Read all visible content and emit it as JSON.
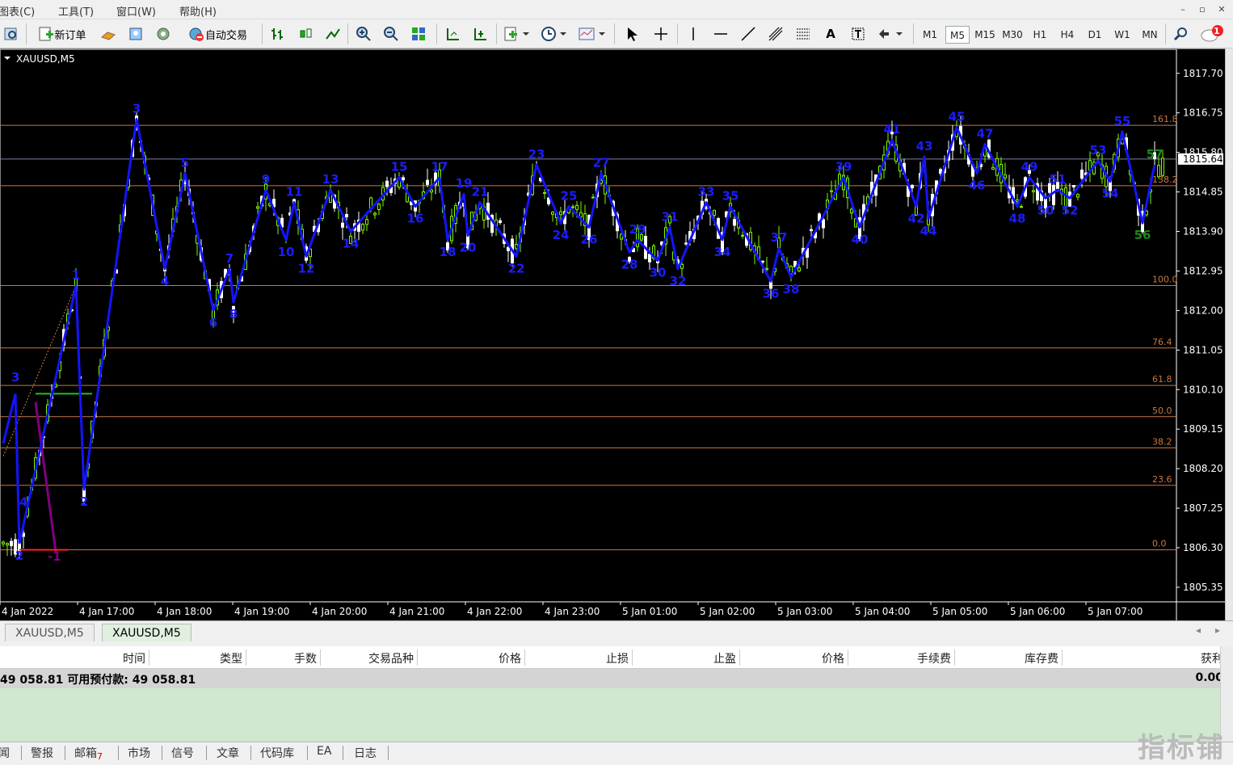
{
  "menu": {
    "items": [
      "图表(C)",
      "工具(T)",
      "窗口(W)",
      "帮助(H)"
    ],
    "controls": [
      "–",
      "▫",
      "✕"
    ]
  },
  "toolbar": {
    "new_order_label": "新订单",
    "auto_trade_label": "自动交易",
    "timeframes": [
      "M1",
      "M5",
      "M15",
      "M30",
      "H1",
      "H4",
      "D1",
      "W1",
      "MN"
    ],
    "active_timeframe": "M5",
    "notification_count": "1"
  },
  "chart": {
    "symbol_label": "XAUUSD,M5",
    "current_price": "1815.64",
    "price_ticks": [
      "1817.70",
      "1816.75",
      "1815.80",
      "1814.85",
      "1813.90",
      "1812.95",
      "1812.00",
      "1811.05",
      "1810.10",
      "1809.15",
      "1808.20",
      "1807.25",
      "1806.30",
      "1805.35"
    ],
    "time_ticks": [
      "4 Jan 2022",
      "4 Jan 17:00",
      "4 Jan 18:00",
      "4 Jan 19:00",
      "4 Jan 20:00",
      "4 Jan 21:00",
      "4 Jan 22:00",
      "4 Jan 23:00",
      "5 Jan 01:00",
      "5 Jan 02:00",
      "5 Jan 03:00",
      "5 Jan 04:00",
      "5 Jan 05:00",
      "5 Jan 06:00",
      "5 Jan 07:00"
    ],
    "fib_levels": [
      {
        "label": "161.8",
        "price": 1816.45
      },
      {
        "label": "138.2",
        "price": 1815.0
      },
      {
        "label": "100.0",
        "price": 1812.6
      },
      {
        "label": "76.4",
        "price": 1811.1
      },
      {
        "label": "61.8",
        "price": 1810.2
      },
      {
        "label": "50.0",
        "price": 1809.45
      },
      {
        "label": "38.2",
        "price": 1808.7
      },
      {
        "label": "23.6",
        "price": 1807.8
      },
      {
        "label": "0.0",
        "price": 1806.25
      }
    ],
    "colors": {
      "zigzag": "#1414ff",
      "fib": "#c87840",
      "label_blue": "#1c1cff",
      "label_green": "#1a8a1a",
      "purple": "#800080",
      "bull": "#7cfc00",
      "bear": "#ffffff"
    }
  },
  "chart_data": {
    "type": "line",
    "title": "XAUUSD,M5",
    "xlabel": "",
    "ylabel": "",
    "ylim": [
      1805.0,
      1818.2
    ],
    "series": [
      {
        "points": [
          {
            "label": "2",
            "t": 4,
            "price": 1806.4
          },
          {
            "label": "1",
            "t": 18,
            "price": 1812.6
          },
          {
            "label": "2",
            "t": 20,
            "price": 1807.7
          },
          {
            "label": "3",
            "t": 33,
            "price": 1816.6
          },
          {
            "label": "4",
            "t": 40,
            "price": 1813.0
          },
          {
            "label": "5",
            "t": 45,
            "price": 1815.3
          },
          {
            "label": "6",
            "t": 52,
            "price": 1812.0
          },
          {
            "label": "7",
            "t": 56,
            "price": 1813.0
          },
          {
            "label": "8",
            "t": 57,
            "price": 1812.2
          },
          {
            "label": "9",
            "t": 65,
            "price": 1814.9
          },
          {
            "label": "10",
            "t": 70,
            "price": 1813.7
          },
          {
            "label": "11",
            "t": 72,
            "price": 1814.6
          },
          {
            "label": "12",
            "t": 75,
            "price": 1813.3
          },
          {
            "label": "13",
            "t": 81,
            "price": 1814.9
          },
          {
            "label": "14",
            "t": 86,
            "price": 1813.9
          },
          {
            "label": "15",
            "t": 98,
            "price": 1815.2
          },
          {
            "label": "16",
            "t": 102,
            "price": 1814.5
          },
          {
            "label": "17",
            "t": 108,
            "price": 1815.2
          },
          {
            "label": "18",
            "t": 110,
            "price": 1813.7
          },
          {
            "label": "19",
            "t": 114,
            "price": 1814.8
          },
          {
            "label": "20",
            "t": 115,
            "price": 1813.8
          },
          {
            "label": "21",
            "t": 118,
            "price": 1814.6
          },
          {
            "label": "22",
            "t": 127,
            "price": 1813.3
          },
          {
            "label": "23",
            "t": 132,
            "price": 1815.5
          },
          {
            "label": "24",
            "t": 138,
            "price": 1814.1
          },
          {
            "label": "25",
            "t": 140,
            "price": 1814.5
          },
          {
            "label": "26",
            "t": 145,
            "price": 1814.0
          },
          {
            "label": "27",
            "t": 148,
            "price": 1815.3
          },
          {
            "label": "28",
            "t": 155,
            "price": 1813.4
          },
          {
            "label": "29",
            "t": 157,
            "price": 1813.7
          },
          {
            "label": "30",
            "t": 162,
            "price": 1813.2
          },
          {
            "label": "31",
            "t": 165,
            "price": 1814.0
          },
          {
            "label": "32",
            "t": 167,
            "price": 1813.0
          },
          {
            "label": "33",
            "t": 174,
            "price": 1814.6
          },
          {
            "label": "34",
            "t": 178,
            "price": 1813.7
          },
          {
            "label": "35",
            "t": 180,
            "price": 1814.5
          },
          {
            "label": "36",
            "t": 190,
            "price": 1812.7
          },
          {
            "label": "37",
            "t": 192,
            "price": 1813.5
          },
          {
            "label": "38",
            "t": 195,
            "price": 1812.8
          },
          {
            "label": "39",
            "t": 208,
            "price": 1815.2
          },
          {
            "label": "40",
            "t": 212,
            "price": 1814.0
          },
          {
            "label": "41",
            "t": 220,
            "price": 1816.1
          },
          {
            "label": "42",
            "t": 226,
            "price": 1814.5
          },
          {
            "label": "43",
            "t": 228,
            "price": 1815.7
          },
          {
            "label": "44",
            "t": 229,
            "price": 1814.2
          },
          {
            "label": "45",
            "t": 236,
            "price": 1816.4
          },
          {
            "label": "46",
            "t": 241,
            "price": 1815.3
          },
          {
            "label": "47",
            "t": 243,
            "price": 1816.0
          },
          {
            "label": "48",
            "t": 251,
            "price": 1814.5
          },
          {
            "label": "49",
            "t": 254,
            "price": 1815.2
          },
          {
            "label": "50",
            "t": 258,
            "price": 1814.7
          },
          {
            "label": "51",
            "t": 261,
            "price": 1814.9
          },
          {
            "label": "52",
            "t": 264,
            "price": 1814.7
          },
          {
            "label": "53",
            "t": 271,
            "price": 1815.6
          },
          {
            "label": "54",
            "t": 274,
            "price": 1815.1
          },
          {
            "label": "55",
            "t": 277,
            "price": 1816.3
          },
          {
            "label": "56",
            "t": 282,
            "price": 1814.1
          },
          {
            "label": "57",
            "t": 285,
            "price": 1815.5
          }
        ]
      }
    ],
    "old_wave_labels": [
      "3",
      "-1",
      "4"
    ]
  },
  "tabs": {
    "chart_tabs": [
      "XAUUSD,M5",
      "XAUUSD,M5"
    ],
    "active_index": 1
  },
  "terminal": {
    "columns": [
      "时间",
      "类型",
      "手数",
      "交易品种",
      "价格",
      "止损",
      "止盈",
      "价格",
      "手续费",
      "库存费",
      "获利"
    ],
    "balance_text": "49 058.81  可用预付款: 49 058.81",
    "profit": "0.00"
  },
  "bottom_tabs": {
    "items": [
      "闻",
      "警报",
      "邮箱",
      "市场",
      "信号",
      "文章",
      "代码库",
      "EA",
      "日志"
    ],
    "mail_badge": "7"
  },
  "watermark": "指标铺"
}
